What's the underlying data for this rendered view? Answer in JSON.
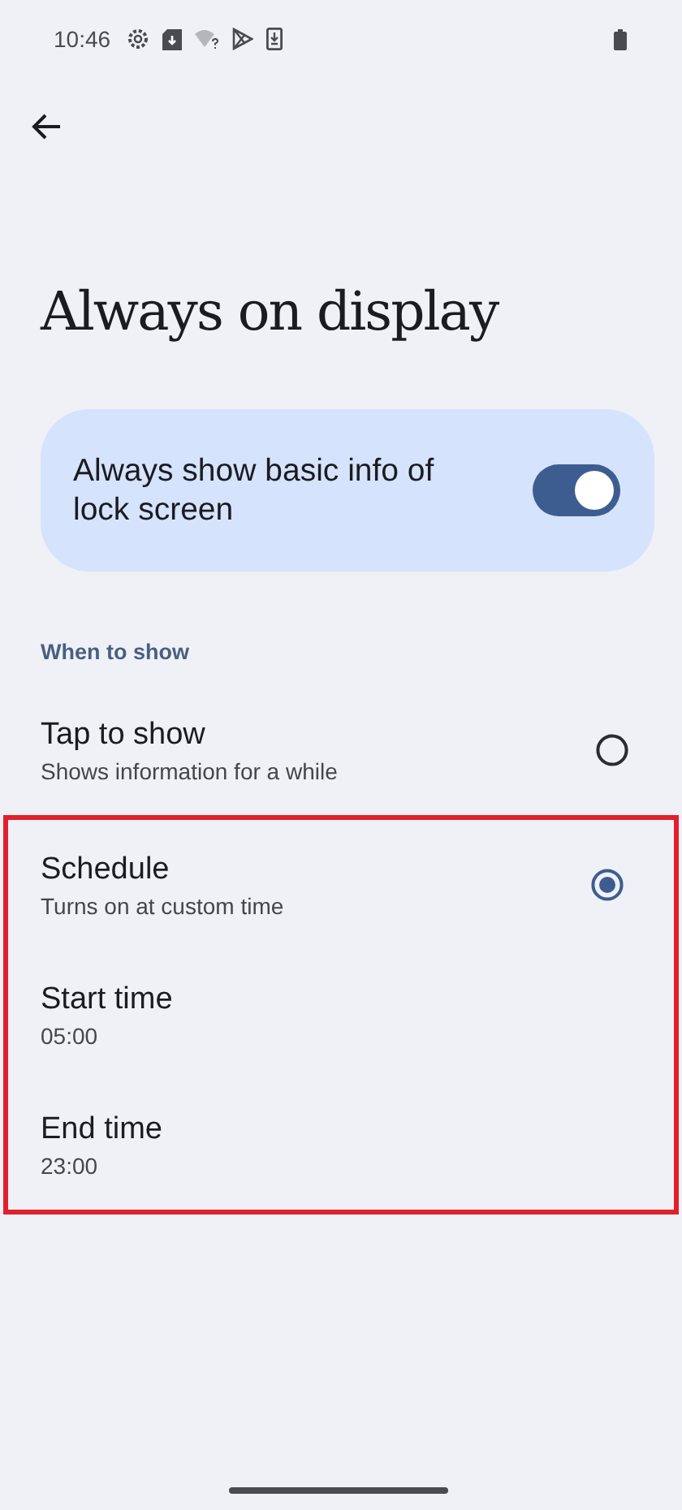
{
  "status_bar": {
    "time": "10:46"
  },
  "title": "Always on display",
  "main_switch": {
    "label": "Always show basic info of lock screen",
    "on": true
  },
  "section": {
    "header": "When to show"
  },
  "options": [
    {
      "kind": "radio",
      "title": "Tap to show",
      "subtitle": "Shows information for a while",
      "selected": false,
      "highlighted": false
    },
    {
      "kind": "radio",
      "title": "Schedule",
      "subtitle": "Turns on at custom time",
      "selected": true,
      "highlighted": true
    },
    {
      "kind": "time",
      "title": "Start time",
      "subtitle": "05:00",
      "highlighted": true
    },
    {
      "kind": "time",
      "title": "End time",
      "subtitle": "23:00",
      "highlighted": true
    }
  ]
}
